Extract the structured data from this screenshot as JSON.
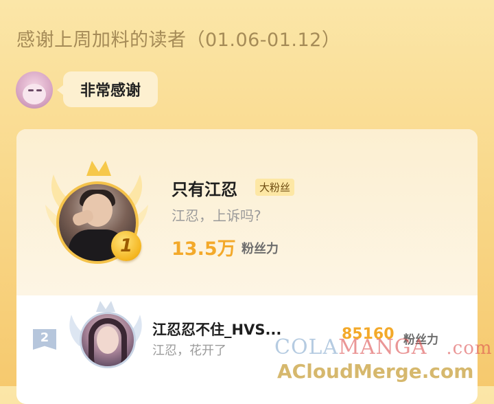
{
  "header": {
    "title": "感谢上周加料的读者（01.06-01.12）"
  },
  "thanks": {
    "label": "非常感谢"
  },
  "leaderboard": [
    {
      "rank": "1",
      "name": "只有江忍",
      "badge": "大粉丝",
      "message": "江忍，上诉吗?",
      "fans": "13.5万",
      "fans_label": "粉丝力"
    },
    {
      "rank": "2",
      "name": "江忍忍不住_HVS...",
      "message": "江忍，花开了",
      "fans": "85160",
      "fans_label": "粉丝力"
    }
  ],
  "watermark": {
    "line1_a": "COLA",
    "line1_b": "MANGA",
    "line1_c": ".com",
    "line2": "ACloudMerge.com"
  },
  "colors": {
    "accent_gold": "#f3a92a",
    "background": "#f9d98c"
  }
}
